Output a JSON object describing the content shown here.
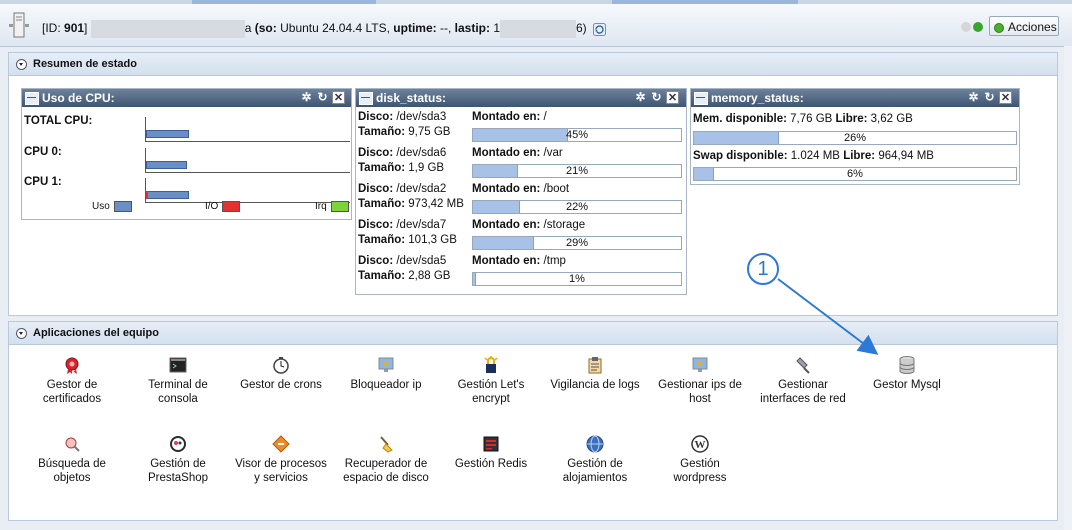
{
  "header": {
    "id_label": "[ID: ",
    "id_value": "901",
    "id_close": "]",
    "server_suffix": "a",
    "so_label": "(so:",
    "so_value": " Ubuntu 24.04.4 LTS, ",
    "uptime_label": "uptime:",
    "uptime_value": " --, ",
    "lastip_label": "lastip:",
    "lastip_prefix": " 1",
    "lastip_suffix": "6)",
    "actions_label": "Acciones",
    "led_colors": [
      "#d6d6d6",
      "#3aa52e"
    ]
  },
  "status_panel": {
    "title": "Resumen de estado",
    "cpu": {
      "title": "Uso de CPU:",
      "rows": [
        {
          "label": "TOTAL CPU:",
          "uso": 0.2,
          "io": 0
        },
        {
          "label": "CPU 0:",
          "uso": 0.19,
          "io": 0
        },
        {
          "label": "CPU 1:",
          "uso": 0.2,
          "io": 0.01
        }
      ],
      "legend": [
        {
          "label": "Uso",
          "color": "#6a8fc6"
        },
        {
          "label": "I/O",
          "color": "#e53030"
        },
        {
          "label": "Irq",
          "color": "#7dd33a"
        }
      ]
    },
    "disk": {
      "title": "disk_status:",
      "disco_label": "Disco:",
      "tamano_label": "Tamaño:",
      "montado_label": "Montado en:",
      "rows": [
        {
          "disk": " /dev/sda3",
          "size": " 9,75 GB",
          "mount": " /",
          "pct": "45%",
          "value": 0.45
        },
        {
          "disk": " /dev/sda6",
          "size": " 1,9 GB",
          "mount": " /var",
          "pct": "21%",
          "value": 0.21
        },
        {
          "disk": " /dev/sda2",
          "size": " 973,42 MB",
          "mount": " /boot",
          "pct": "22%",
          "value": 0.22
        },
        {
          "disk": " /dev/sda7",
          "size": " 101,3 GB",
          "mount": " /storage",
          "pct": "29%",
          "value": 0.29
        },
        {
          "disk": " /dev/sda5",
          "size": " 2,88 GB",
          "mount": " /tmp",
          "pct": "1%",
          "value": 0.01
        }
      ]
    },
    "memory": {
      "title": "memory_status:",
      "mem_label": "Mem. disponible:",
      "mem_value": " 7,76 GB ",
      "mem_free_label": "Libre:",
      "mem_free_value": " 3,62 GB",
      "mem_pct": "26%",
      "mem_fill": 0.26,
      "swap_label": "Swap disponible:",
      "swap_value": " 1.024 MB ",
      "swap_free_label": "Libre:",
      "swap_free_value": " 964,94 MB",
      "swap_pct": "6%",
      "swap_fill": 0.06
    }
  },
  "apps_panel": {
    "title": "Aplicaciones del equipo",
    "row1": [
      {
        "l1": "Gestor de",
        "l2": "certificados",
        "icon": "certificate-seal-icon"
      },
      {
        "l1": "Terminal de",
        "l2": "consola",
        "icon": "terminal-icon"
      },
      {
        "l1": "Gestor de crons",
        "l2": "",
        "icon": "clock-icon"
      },
      {
        "l1": "Bloqueador ip",
        "l2": "",
        "icon": "monitor-lock-icon"
      },
      {
        "l1": "Gestión Let's",
        "l2": "encrypt",
        "icon": "letsencrypt-icon"
      },
      {
        "l1": "Vigilancia de logs",
        "l2": "",
        "icon": "clipboard-icon"
      },
      {
        "l1": "Gestionar ips de",
        "l2": "host",
        "icon": "monitor-icon"
      },
      {
        "l1": "Gestionar",
        "l2": "interfaces de red",
        "icon": "network-plug-icon"
      },
      {
        "l1": "Gestor Mysql",
        "l2": "",
        "icon": "database-icon"
      }
    ],
    "row2": [
      {
        "l1": "Búsqueda de",
        "l2": "objetos",
        "icon": "magnifier-icon"
      },
      {
        "l1": "Gestión de",
        "l2": "PrestaShop",
        "icon": "prestashop-icon"
      },
      {
        "l1": "Visor de procesos",
        "l2": "y servicios",
        "icon": "process-diamond-icon"
      },
      {
        "l1": "Recuperador de",
        "l2": "espacio de disco",
        "icon": "broom-icon"
      },
      {
        "l1": "Gestión Redis",
        "l2": "",
        "icon": "redis-icon"
      },
      {
        "l1": "Gestión de",
        "l2": "alojamientos",
        "icon": "globe-icon"
      },
      {
        "l1": "Gestión",
        "l2": "wordpress",
        "icon": "wordpress-icon"
      }
    ]
  },
  "annotation": {
    "callout_number": "1",
    "color": "#2b79d8"
  }
}
